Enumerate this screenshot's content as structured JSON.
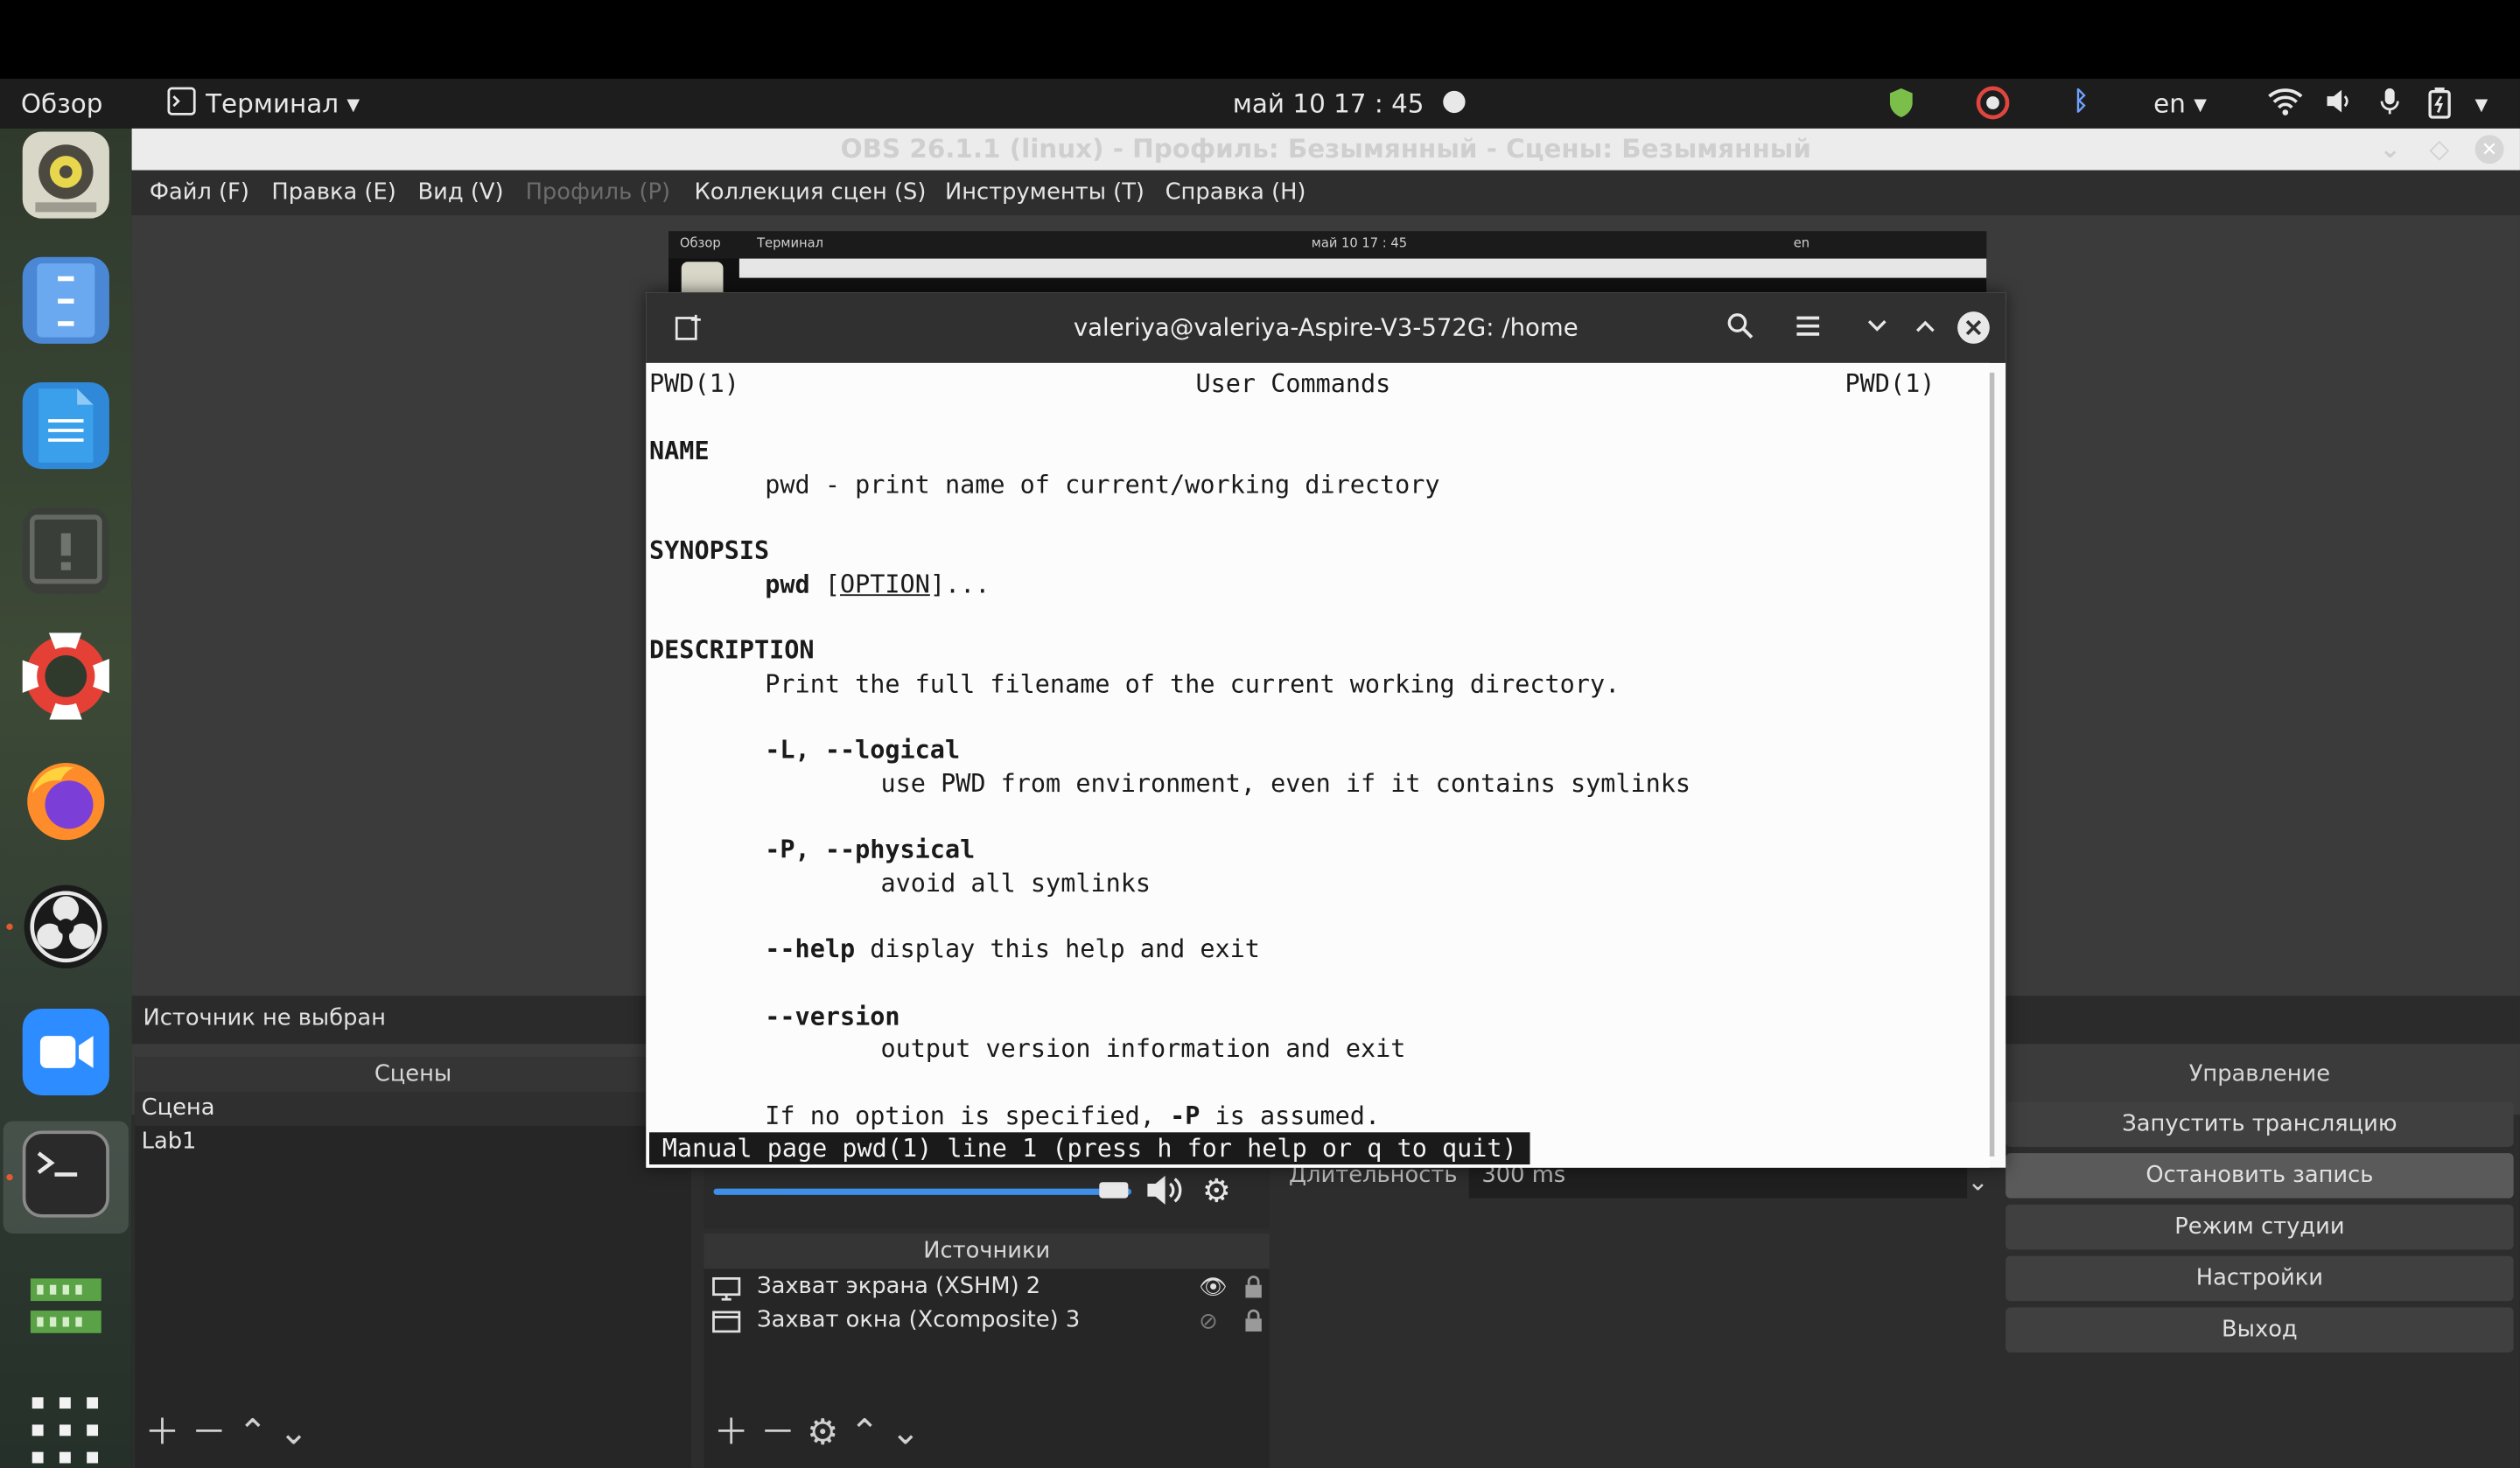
{
  "topbar": {
    "activities": "Обзор",
    "app_menu": "Терминал",
    "clock": "май 10 17 : 45",
    "keyboard_layout": "en"
  },
  "obs": {
    "title": "OBS 26.1.1 (linux) - Профиль: Безымянный - Сцены: Безымянный",
    "menu": {
      "file": "Файл (F)",
      "edit": "Правка (E)",
      "view": "Вид (V)",
      "profile": "Профиль (P)",
      "scene_collection": "Коллекция сцен (S)",
      "tools": "Инструменты (T)",
      "help": "Справка (H)"
    },
    "source_status": "Источник не выбран",
    "scenes_header": "Сцены",
    "scenes": [
      "Сцена",
      "Lab1"
    ],
    "sources_header": "Источники",
    "sources": [
      "Захват экрана (XSHM) 2",
      "Захват окна (Xcomposite) 3"
    ],
    "transition_duration_label": "Длительность",
    "transition_duration_value": "300 ms",
    "controls_header": "Управление",
    "controls": {
      "start_stream": "Запустить трансляцию",
      "stop_recording": "Остановить запись",
      "studio_mode": "Режим студии",
      "settings": "Настройки",
      "exit": "Выход"
    },
    "nested_preview": {
      "activities": "Обзор",
      "app_menu": "Терминал",
      "clock": "май 10 17 : 45",
      "keyboard_layout": "en"
    }
  },
  "terminal": {
    "title": "valeriya@valeriya-Aspire-V3-572G: /home",
    "man": {
      "header_left": "PWD(1)",
      "header_center": "User Commands",
      "header_right": "PWD(1)",
      "name_heading": "NAME",
      "name_line": "pwd - print name of current/working directory",
      "synopsis_heading": "SYNOPSIS",
      "synopsis_cmd": "pwd",
      "synopsis_option": "OPTION",
      "description_heading": "DESCRIPTION",
      "description_text": "Print the full filename of the current working directory.",
      "opt_l_flag": "-L, --logical",
      "opt_l_desc": "use PWD from environment, even if it contains symlinks",
      "opt_p_flag": "-P, --physical",
      "opt_p_desc": "avoid all symlinks",
      "help_flag": "--help",
      "help_desc": "display this help and exit",
      "version_flag": "--version",
      "version_desc": "output version information and exit",
      "default_note_pre": "If no option is specified,",
      "default_note_flag": "-P",
      "default_note_post": "is assumed.",
      "status_line": "Manual page pwd(1) line 1 (press h for help or q to quit)"
    }
  },
  "colors": {
    "topbar_bg": "#1d1d1d",
    "obs_bg": "#2d2d2d",
    "terminal_header_bg": "#303030",
    "terminal_body_bg": "#fcfcfc",
    "accent_blue": "#3f8ee8"
  },
  "icons": [
    "terminal-icon",
    "record-indicator",
    "shield-icon",
    "chrome-icon",
    "bluetooth-icon",
    "wifi-icon",
    "volume-icon",
    "mic-icon",
    "battery-icon",
    "power-menu-icon",
    "speaker-icon",
    "gear-icon",
    "eye-icon",
    "eye-hidden-icon",
    "lock-icon",
    "monitor-icon",
    "window-icon",
    "plus-icon",
    "minus-icon",
    "up-icon",
    "down-icon",
    "search-icon",
    "hamburger-icon",
    "close-icon"
  ]
}
